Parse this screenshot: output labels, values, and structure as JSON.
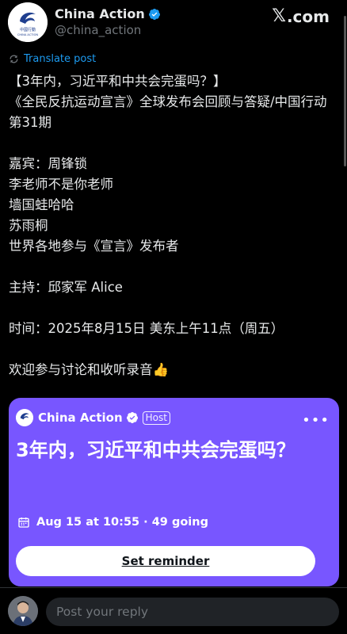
{
  "header": {
    "name": "China Action",
    "handle": "@china_action",
    "avatar_text_top": "中國行動",
    "avatar_text_bottom": "CHINA ACTION",
    "platform": "X.com",
    "platform_x": "𝕏",
    "platform_rest": ".com"
  },
  "translate": {
    "label": "Translate post"
  },
  "tweet": {
    "lines": [
      "【3年内，习近平和中共会完蛋吗？】",
      "《全民反抗运动宣言》全球发布会回顾与答疑/中国行动 第31期",
      "",
      "嘉宾：周锋锁",
      "李老师不是你老师",
      "墙国蛙哈哈",
      "苏雨桐",
      "世界各地参与《宣言》发布者",
      "",
      "主持：邱家军 Alice",
      "",
      "时间：2025年8月15日 美东上午11点（周五）",
      "",
      "欢迎参与讨论和收听录音👍"
    ]
  },
  "space_card": {
    "host_name": "China Action",
    "host_badge": "Host",
    "title": "3年内，习近平和中共会完蛋吗？",
    "meta": "Aug 15 at 10:55 · 49 going",
    "button": "Set reminder",
    "more": "•••",
    "bg_color": "#7856ff"
  },
  "reply": {
    "placeholder": "Post your reply"
  },
  "colors": {
    "accent": "#1d9bf0",
    "background": "#000000",
    "verified": "#1d9bf0"
  },
  "icons": {
    "verified": "verified-badge-icon",
    "translate": "translate-icon",
    "calendar": "calendar-icon",
    "more": "more-dots-icon",
    "x_logo": "x-logo-icon"
  }
}
